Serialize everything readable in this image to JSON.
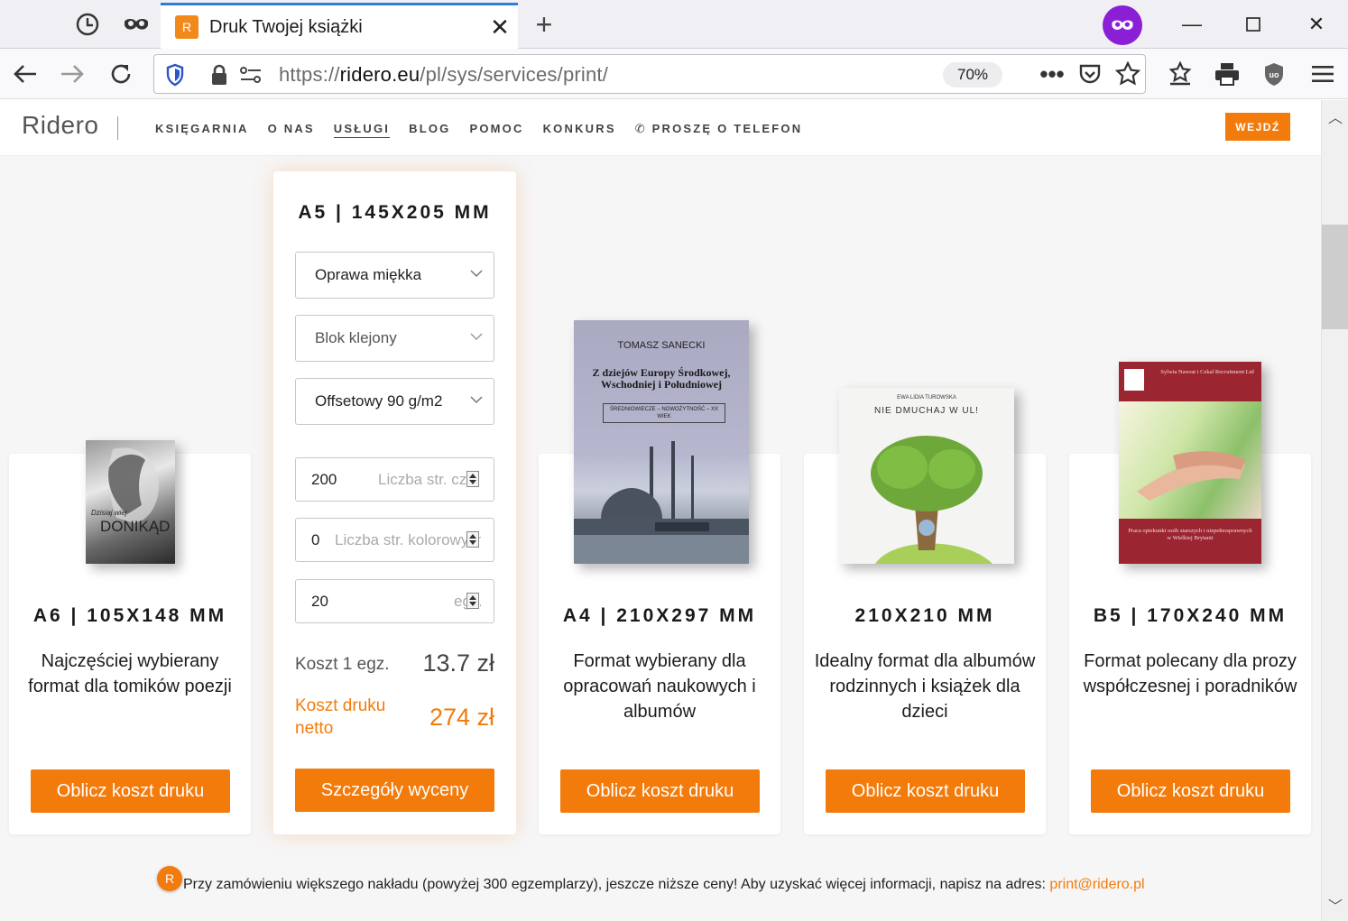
{
  "browser": {
    "tab_title": "Druk Twojej książki",
    "url_prefix": "https://",
    "url_domain": "ridero.eu",
    "url_path": "/pl/sys/services/print/",
    "zoom": "70%"
  },
  "header": {
    "logo": "Ridero",
    "menu": [
      "KSIĘGARNIA",
      "O NAS",
      "USŁUGI",
      "BLOG",
      "POMOC",
      "KONKURS",
      "PROSZĘ O TELEFON"
    ],
    "login": "WEJDŹ"
  },
  "cards": [
    {
      "format": "A6 | 105X148 MM",
      "desc": "Najczęściej wybierany format dla tomików poezji",
      "button": "Oblicz koszt druku"
    },
    {
      "format": "A4 | 210X297 MM",
      "desc": "Format wybierany dla opracowań naukowych i albumów",
      "button": "Oblicz koszt druku"
    },
    {
      "format": "210X210 MM",
      "desc": "Idealny format dla albumów rodzinnych i książek dla dzieci",
      "button": "Oblicz koszt druku"
    },
    {
      "format": "B5 | 170X240 MM",
      "desc": "Format polecany dla prozy współczesnej i poradników",
      "button": "Oblicz koszt druku"
    }
  ],
  "calculator": {
    "format": "A5 | 145X205 MM",
    "binding": "Oprawa miękka",
    "block": "Blok klejony",
    "paper": "Offsetowy 90 g/m2",
    "bw_pages": "200",
    "bw_placeholder": "Liczba str. cz/b",
    "color_pages": "0",
    "color_placeholder": "Liczba str. kolorowych",
    "copies": "20",
    "copies_placeholder": "egz.",
    "unit_cost_label": "Koszt 1 egz.",
    "unit_cost": "13.7 zł",
    "net_label": "Koszt druku netto",
    "net_cost": "274 zł",
    "button": "Szczegóły wyceny"
  },
  "books": {
    "a6_line1": "Dzisiaj wiej",
    "a6_title": "DONIKĄD",
    "a4_author": "TOMASZ SANECKI",
    "a4_title": "Z dziejów Europy Środkowej, Wschodniej i Południowej",
    "a4_sub": "ŚREDNIOWIECZE – NOWOŻYTNOŚĆ – XX WIEK",
    "sq_author": "EWA LIDIA TUROWSKA",
    "sq_title": "NIE DMUCHAJ W UL!",
    "b5_author": "Sylwia Nawrat i Cekal Recruitment Ltd",
    "b5_title": "Praca opiekunki osób starszych i niepełnosprawnych w Wielkiej Brytanii"
  },
  "footnote": {
    "text": "Przy zamówieniu większego nakładu (powyżej 300 egzemplarzy), jeszcze niższe ceny! Aby uzyskać więcej informacji, napisz na adres: ",
    "email": "print@ridero.pl"
  },
  "colors": {
    "accent": "#f37b0b",
    "private": "#8a1fd6",
    "tab_line": "#2b7fd9"
  }
}
